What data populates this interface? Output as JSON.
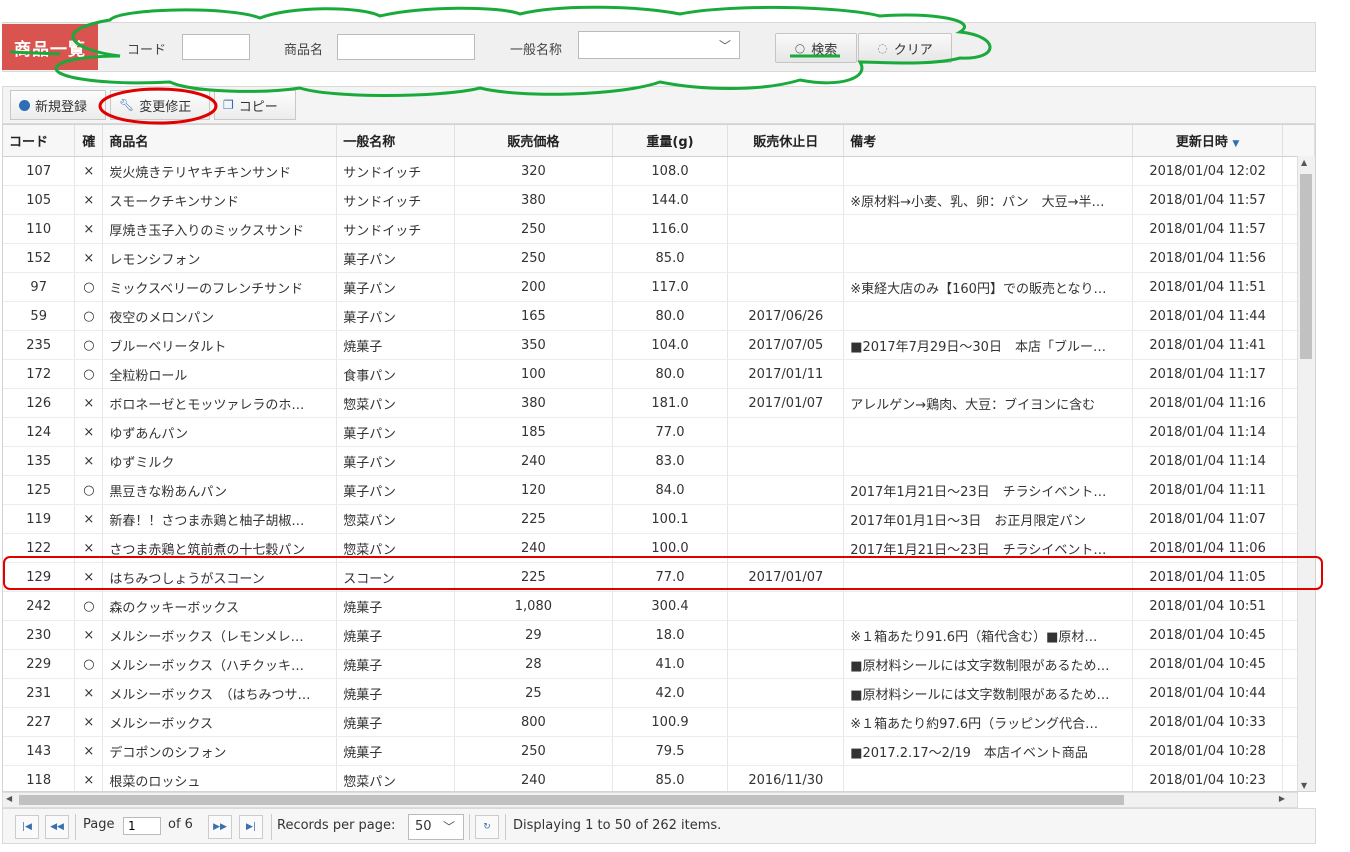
{
  "search": {
    "title": "商品一覧",
    "code_label": "コード",
    "name_label": "商品名",
    "general_label": "一般名称",
    "search_label": "検索",
    "clear_label": "クリア"
  },
  "toolbar": {
    "new_label": "新規登録",
    "edit_label": "変更修正",
    "copy_label": "コピー"
  },
  "columns": [
    "コード",
    "確",
    "商品名",
    "一般名称",
    "販売価格",
    "重量(g)",
    "販売休止日",
    "備考",
    "更新日時"
  ],
  "rows": [
    [
      "107",
      "×",
      "炭火焼きテリヤキチキンサンド",
      "サンドイッチ",
      "320",
      "108.0",
      "",
      "",
      "2018/01/04 12:02"
    ],
    [
      "105",
      "×",
      "スモークチキンサンド",
      "サンドイッチ",
      "380",
      "144.0",
      "",
      "※原材料→小麦、乳、卵：パン　大豆→半…",
      "2018/01/04 11:57"
    ],
    [
      "110",
      "×",
      "厚焼き玉子入りのミックスサンド",
      "サンドイッチ",
      "250",
      "116.0",
      "",
      "",
      "2018/01/04 11:57"
    ],
    [
      "152",
      "×",
      "レモンシフォン",
      "菓子パン",
      "250",
      "85.0",
      "",
      "",
      "2018/01/04 11:56"
    ],
    [
      "97",
      "○",
      "ミックスベリーのフレンチサンド",
      "菓子パン",
      "200",
      "117.0",
      "",
      "※東経大店のみ【160円】での販売となり…",
      "2018/01/04 11:51"
    ],
    [
      "59",
      "○",
      "夜空のメロンパン",
      "菓子パン",
      "165",
      "80.0",
      "2017/06/26",
      "",
      "2018/01/04 11:44"
    ],
    [
      "235",
      "○",
      "ブルーベリータルト",
      "焼菓子",
      "350",
      "104.0",
      "2017/07/05",
      "■2017年7月29日～30日　本店「ブルー…",
      "2018/01/04 11:41"
    ],
    [
      "172",
      "○",
      "全粒粉ロール",
      "食事パン",
      "100",
      "80.0",
      "2017/01/11",
      "",
      "2018/01/04 11:17"
    ],
    [
      "126",
      "×",
      "ボロネーゼとモッツァレラのホ…",
      "惣菜パン",
      "380",
      "181.0",
      "2017/01/07",
      "アレルゲン→鶏肉、大豆：ブイヨンに含む",
      "2018/01/04 11:16"
    ],
    [
      "124",
      "×",
      "ゆずあんパン",
      "菓子パン",
      "185",
      "77.0",
      "",
      "",
      "2018/01/04 11:14"
    ],
    [
      "135",
      "×",
      "ゆずミルク",
      "菓子パン",
      "240",
      "83.0",
      "",
      "",
      "2018/01/04 11:14"
    ],
    [
      "125",
      "○",
      "黒豆きな粉あんパン",
      "菓子パン",
      "120",
      "84.0",
      "",
      "2017年1月21日～23日　チラシイベント…",
      "2018/01/04 11:11"
    ],
    [
      "119",
      "×",
      "新春！！さつま赤鶏と柚子胡椒…",
      "惣菜パン",
      "225",
      "100.1",
      "",
      "2017年01月1日～3日　お正月限定パン",
      "2018/01/04 11:07"
    ],
    [
      "122",
      "×",
      "さつま赤鶏と筑前煮の十七穀パン",
      "惣菜パン",
      "240",
      "100.0",
      "",
      "2017年1月21日～23日　チラシイベント…",
      "2018/01/04 11:06"
    ],
    [
      "129",
      "×",
      "はちみつしょうがスコーン",
      "スコーン",
      "225",
      "77.0",
      "2017/01/07",
      "",
      "2018/01/04 11:05"
    ],
    [
      "242",
      "○",
      "森のクッキーボックス",
      "焼菓子",
      "1,080",
      "300.4",
      "",
      "",
      "2018/01/04 10:51"
    ],
    [
      "230",
      "×",
      "メルシーボックス（レモンメレ…",
      "焼菓子",
      "29",
      "18.0",
      "",
      "※１箱あたり91.6円（箱代含む）■原材…",
      "2018/01/04 10:45"
    ],
    [
      "229",
      "○",
      "メルシーボックス（ハチクッキ…",
      "焼菓子",
      "28",
      "41.0",
      "",
      "■原材料シールには文字数制限があるため…",
      "2018/01/04 10:45"
    ],
    [
      "231",
      "×",
      "メルシーボックス　（はちみつサ…",
      "焼菓子",
      "25",
      "42.0",
      "",
      "■原材料シールには文字数制限があるため…",
      "2018/01/04 10:44"
    ],
    [
      "227",
      "×",
      "メルシーボックス",
      "焼菓子",
      "800",
      "100.9",
      "",
      "※１箱あたり約97.6円（ラッピング代合…",
      "2018/01/04 10:33"
    ],
    [
      "143",
      "×",
      "デコポンのシフォン",
      "焼菓子",
      "250",
      "79.5",
      "",
      "■2017.2.17～2/19　本店イベント商品",
      "2018/01/04 10:28"
    ],
    [
      "118",
      "×",
      "根菜のロッシュ",
      "惣菜パン",
      "240",
      "85.0",
      "2016/11/30",
      "",
      "2018/01/04 10:23"
    ]
  ],
  "pager": {
    "page_label": "Page",
    "page_value": "1",
    "of_label": "of 6",
    "records_label": "Records per page:",
    "records_value": "50",
    "display_text": "Displaying 1 to 50 of 262 items."
  },
  "colors": {
    "title_bg": "#d9534f",
    "annotation_green": "#1aaa3c",
    "annotation_red": "#e00000"
  }
}
